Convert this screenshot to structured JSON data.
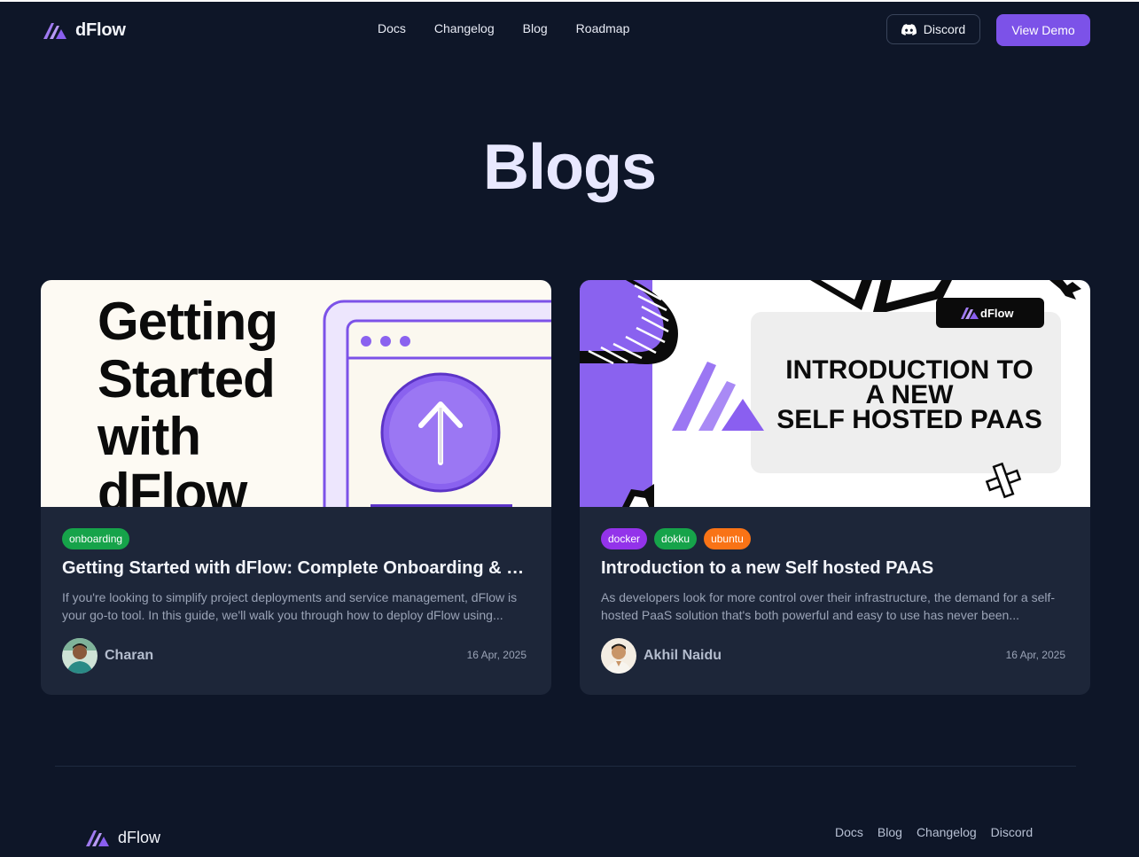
{
  "brand": {
    "name": "dFlow"
  },
  "nav": {
    "links": [
      "Docs",
      "Changelog",
      "Blog",
      "Roadmap"
    ],
    "discord_label": "Discord",
    "demo_label": "View Demo"
  },
  "page": {
    "title": "Blogs"
  },
  "posts": [
    {
      "thumbnail_text": [
        "Getting",
        "Started",
        "with",
        "dFlow"
      ],
      "tags": [
        "onboarding"
      ],
      "title": "Getting Started with dFlow: Complete Onboarding & Setup Guide",
      "excerpt": "If you're looking to simplify project deployments and service management, dFlow is your go-to tool. In this guide, we'll walk you through how to deploy dFlow using...",
      "author": "Charan",
      "date": "16 Apr, 2025"
    },
    {
      "thumbnail_badge": "dFlow",
      "thumbnail_text": [
        "INTRODUCTION TO",
        "A NEW",
        "SELF HOSTED PAAS"
      ],
      "tags": [
        "docker",
        "dokku",
        "ubuntu"
      ],
      "title": "Introduction to a new Self hosted PAAS",
      "excerpt": "As developers look for more control over their infrastructure, the demand for a self-hosted PaaS solution that's both powerful and easy to use has never been...",
      "author": "Akhil Naidu",
      "date": "16 Apr, 2025"
    }
  ],
  "footer": {
    "brand": "dFlow",
    "links": [
      "Docs",
      "Blog",
      "Changelog",
      "Discord"
    ]
  },
  "colors": {
    "background": "#0e1628",
    "card": "#1d2639",
    "accent": "#7c52e8",
    "tag_onboarding": "#16a34a",
    "tag_docker": "#9333ea",
    "tag_dokku": "#16a34a",
    "tag_ubuntu": "#f97316"
  },
  "icons": [
    "dflow-logo-icon",
    "discord-icon",
    "upload-arrow-icon"
  ]
}
